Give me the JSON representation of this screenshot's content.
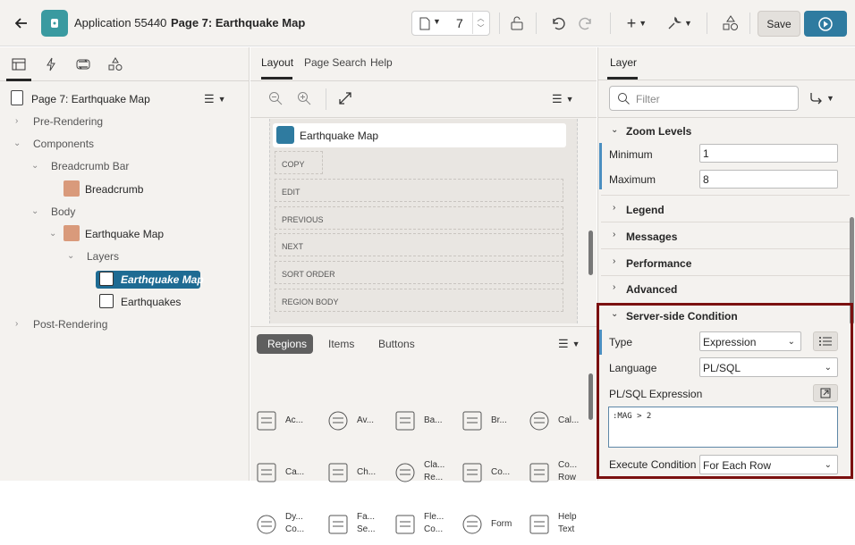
{
  "header": {
    "app_name": "Application 55440",
    "page_name": "Page 7: Earthquake Map",
    "page_number": "7",
    "save_label": "Save"
  },
  "tree": {
    "root": "Page 7: Earthquake Map",
    "pre_rendering": "Pre-Rendering",
    "components": "Components",
    "breadcrumb_bar": "Breadcrumb Bar",
    "breadcrumb": "Breadcrumb",
    "body": "Body",
    "earthquake_map": "Earthquake Map",
    "layers": "Layers",
    "layer_selected": "Earthquake Map",
    "earthquakes": "Earthquakes",
    "post_rendering": "Post-Rendering"
  },
  "middle": {
    "tabs": [
      "Layout",
      "Page Search",
      "Help"
    ],
    "region_title": "Earthquake Map",
    "slots": [
      "COPY",
      "EDIT",
      "PREVIOUS",
      "NEXT",
      "SORT ORDER",
      "REGION BODY"
    ],
    "gallery_tabs": [
      "Regions",
      "Items",
      "Buttons"
    ],
    "gallery_items": [
      [
        "Ac...",
        ""
      ],
      [
        "Av...",
        ""
      ],
      [
        "Ba...",
        ""
      ],
      [
        "Br...",
        ""
      ],
      [
        "Cal...",
        ""
      ],
      [
        "Ca...",
        ""
      ],
      [
        "Ch...",
        ""
      ],
      [
        "Cla...",
        "Re..."
      ],
      [
        "Co...",
        ""
      ],
      [
        "Co...",
        "Row"
      ],
      [
        "Dy...",
        "Co..."
      ],
      [
        "Fa...",
        "Se..."
      ],
      [
        "Fle...",
        "Co..."
      ],
      [
        "Form",
        ""
      ],
      [
        "Help",
        "Text"
      ]
    ]
  },
  "right": {
    "tab": "Layer",
    "filter_placeholder": "Filter",
    "zoom_levels": "Zoom Levels",
    "minimum_label": "Minimum",
    "minimum_value": "1",
    "maximum_label": "Maximum",
    "maximum_value": "8",
    "legend": "Legend",
    "messages": "Messages",
    "performance": "Performance",
    "advanced": "Advanced",
    "server_side_condition": "Server-side Condition",
    "type_label": "Type",
    "type_value": "Expression",
    "language_label": "Language",
    "language_value": "PL/SQL",
    "plsql_label": "PL/SQL Expression",
    "plsql_value": ":MAG > 2",
    "execute_label": "Execute Condition",
    "execute_value": "For Each Row"
  },
  "colors": {
    "accent": "#2f7ba0",
    "highlight_border": "#7b1010",
    "app_icon": "#3a9aa0"
  }
}
